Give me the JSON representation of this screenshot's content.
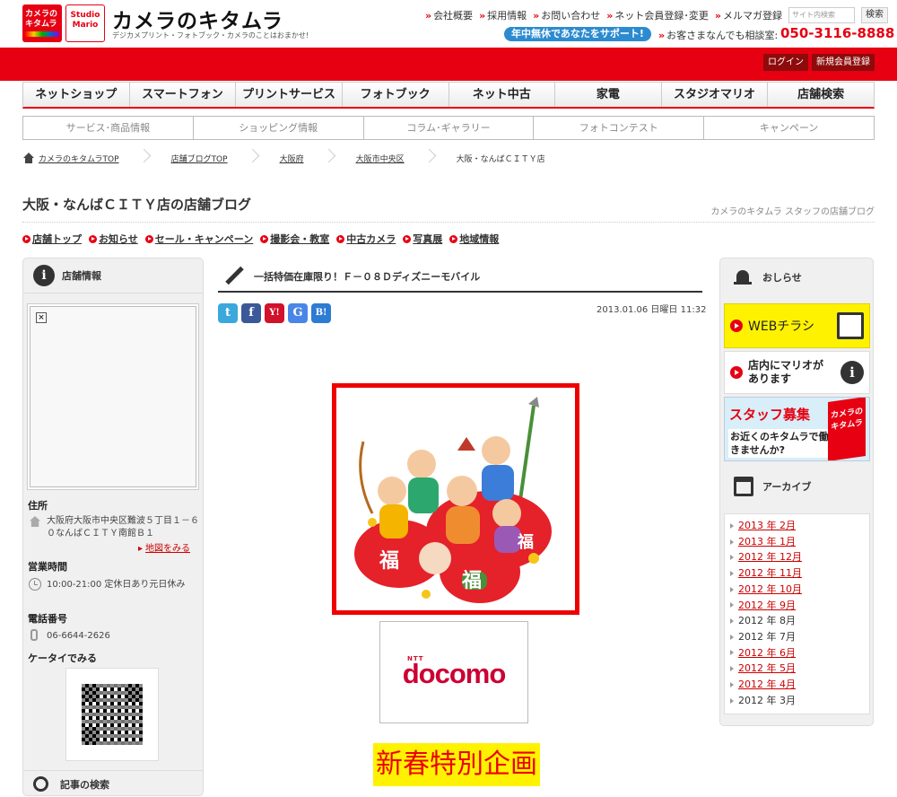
{
  "header": {
    "logo1_text": "カメラのキタムラ",
    "logo2_text": "Studio Mario",
    "brand": "カメラのキタムラ",
    "tagline": "デジカメプリント・フォトブック・カメラのことはおまかせ!",
    "links": [
      "会社概要",
      "採用情報",
      "お問い合わせ",
      "ネット会員登録･変更",
      "メルマガ登録"
    ],
    "search_placeholder": "サイト内検索",
    "search_button": "検索",
    "support_badge": "年中無休であなたをサポート!",
    "consult_text": "お客さまなんでも相談室:",
    "phone": "050-3116-8888",
    "login": "ログイン",
    "register": "新規会員登録"
  },
  "main_nav": [
    "ネットショップ",
    "スマートフォン",
    "プリントサービス",
    "フォトブック",
    "ネット中古",
    "家電",
    "スタジオマリオ",
    "店舗検索"
  ],
  "sub_nav": [
    "サービス･商品情報",
    "ショッピング情報",
    "コラム･ギャラリー",
    "フォトコンテスト",
    "キャンペーン"
  ],
  "breadcrumb": [
    "カメラのキタムラTOP",
    "店舗ブログTOP",
    "大阪府",
    "大阪市中央区",
    "大阪・なんばＣＩＴＹ店"
  ],
  "blog": {
    "title": "大阪・なんばＣＩＴＹ店の店舗ブログ",
    "staff_blog": "カメラのキタムラ スタッフの店舗ブログ",
    "nav": [
      "店舗トップ",
      "お知らせ",
      "セール・キャンペーン",
      "撮影会・教室",
      "中古カメラ",
      "写真展",
      "地域情報"
    ]
  },
  "left": {
    "head": "店舗情報",
    "address_label": "住所",
    "address": "大阪府大阪市中央区難波５丁目１－６０なんばＣＩＴＹ南館Ｂ１",
    "map_link": "地図をみる",
    "hours_label": "営業時間",
    "hours": "10:00-21:00 定休日あり元日休み",
    "tel_label": "電話番号",
    "tel": "06-6644-2626",
    "mobile_label": "ケータイでみる",
    "search_head": "記事の検索"
  },
  "post": {
    "title": "一括特価在庫限り！Ｆ－０８Ｄディズニーモバイル",
    "date": "2013.01.06 日曜日 11:32",
    "share_icons": [
      "twitter-icon",
      "facebook-icon",
      "yahoo-icon",
      "google-icon",
      "hatena-icon"
    ],
    "share_labels": [
      "t",
      "f",
      "Y!",
      "G",
      "B!"
    ],
    "fuku_chars": [
      "福",
      "福",
      "福"
    ],
    "ntt_label": "NTT",
    "docomo_label": "docomo",
    "promo": "新春特別企画"
  },
  "right": {
    "notice_head": "おしらせ",
    "web_flyer": "WEBチラシ",
    "mario_card": [
      "店内にマリオが",
      "あります"
    ],
    "staff_headline": "スタッフ募集",
    "staff_text": "お近くのキタムラで働きませんか?",
    "staff_logo": "カメラのキタムラ",
    "archive_head": "アーカイブ",
    "archive": [
      {
        "label": "2013 年 2月",
        "link": true
      },
      {
        "label": "2013 年 1月",
        "link": true
      },
      {
        "label": "2012 年 12月",
        "link": true
      },
      {
        "label": "2012 年 11月",
        "link": true
      },
      {
        "label": "2012 年 10月",
        "link": true
      },
      {
        "label": "2012 年 9月",
        "link": true
      },
      {
        "label": "2012 年 8月",
        "link": false
      },
      {
        "label": "2012 年 7月",
        "link": false
      },
      {
        "label": "2012 年 6月",
        "link": true
      },
      {
        "label": "2012 年 5月",
        "link": true
      },
      {
        "label": "2012 年 4月",
        "link": true
      },
      {
        "label": "2012 年 3月",
        "link": false
      }
    ]
  },
  "colors": {
    "brand_red": "#e60012",
    "promo_yellow": "#fff200",
    "support_blue": "#2c8bd0"
  }
}
